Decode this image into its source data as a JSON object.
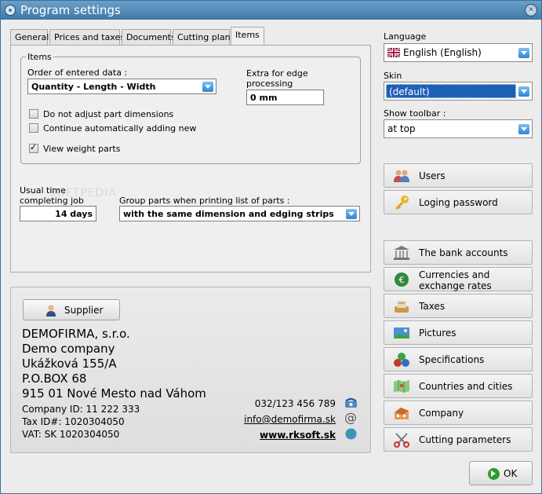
{
  "window": {
    "title": "Program settings"
  },
  "tabs": [
    "General",
    "Prices and taxes",
    "Documents",
    "Cutting plans",
    "Items"
  ],
  "items": {
    "group_title": "Items",
    "order_label": "Order of entered data :",
    "order_value": "Quantity - Length - Width",
    "extra_label": "Extra for edge processing",
    "extra_value": "0 mm",
    "chk_no_adjust": "Do not adjust part dimensions",
    "chk_continue": "Continue automatically adding new",
    "chk_weight": "View weight parts",
    "usual_time_label": "Usual time completing job",
    "usual_time_value": "14 days",
    "group_label": "Group parts when printing list of parts :",
    "group_value": "with the same dimension and edging strips"
  },
  "company": {
    "supplier_button": "Supplier",
    "name": "DEMOFIRMA, s.r.o.",
    "name2": "Demo company",
    "street": "Ukážková 155/A",
    "pobox": "P.O.BOX 68",
    "city": "915 01  Nové Mesto nad Váhom",
    "company_id": "Company ID: 11 222 333",
    "tax_id": "Tax ID#: 1020304050",
    "vat": "VAT: SK 1020304050",
    "phone": "032/123 456 789",
    "email": "info@demofirma.sk",
    "web": "www.rksoft.sk"
  },
  "side": {
    "language_label": "Language",
    "language_value": "English (English)",
    "skin_label": "Skin",
    "skin_value": "(default)",
    "toolbar_label": "Show toolbar :",
    "toolbar_value": "at top",
    "buttons": [
      {
        "label": "Users",
        "icon": "users-icon"
      },
      {
        "label": "Loging password",
        "icon": "key-icon"
      },
      {
        "label": "The bank accounts",
        "icon": "bank-icon"
      },
      {
        "label": "Currencies and exchange rates",
        "icon": "currency-icon"
      },
      {
        "label": "Taxes",
        "icon": "taxes-icon"
      },
      {
        "label": "Pictures",
        "icon": "picture-icon"
      },
      {
        "label": "Specifications",
        "icon": "specifications-icon"
      },
      {
        "label": "Countries and cities",
        "icon": "map-icon"
      },
      {
        "label": "Company",
        "icon": "company-icon"
      },
      {
        "label": "Cutting parameters",
        "icon": "scissors-icon"
      }
    ],
    "ok": "OK"
  },
  "watermark": "SOFTPEDIA",
  "colors": {
    "title_bar": "#3f78a8",
    "accent": "#2d86d6",
    "selection": "#1f5fb6"
  }
}
